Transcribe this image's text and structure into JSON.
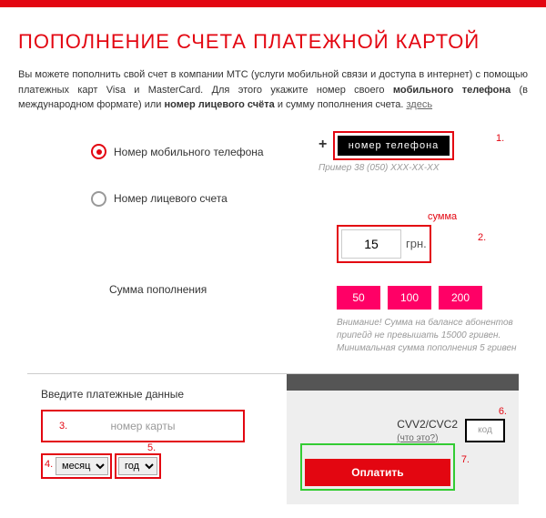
{
  "title": "ПОПОЛНЕНИЕ СЧЕТА ПЛАТЕЖНОЙ КАРТОЙ",
  "intro": {
    "p1": "Вы можете пополнить свой счет в компании МТС (услуги мобильной связи и доступа в интернет) с помощью платежных карт Visa и MasterCard. Для этого укажите номер своего ",
    "b1": "мобильного телефона",
    "p2": " (в международном формате) или ",
    "b2": "номер лицевого счёта",
    "p3": " и сумму пополнения счета. ",
    "link": "здесь"
  },
  "form": {
    "opt1": "Номер мобильного телефона",
    "opt2": "Номер лицевого счета",
    "phone_ph": "номер телефона",
    "phone_hint": "Пример 38 (050) XXX-XX-XX",
    "amount_label": "Сумма пополнения",
    "amount_val": "15",
    "currency": "грн.",
    "anno_sum": "сумма",
    "chips": [
      "50",
      "100",
      "200"
    ],
    "warn": "Внимание! Сумма на балансе абонентов припейд не превышать 15000 гривен. Минимальная сумма пополнения 5 гривен"
  },
  "card": {
    "title": "Введите платежные данные",
    "num_ph": "номер карты",
    "month": "месяц",
    "year": "год",
    "cvv_label": "CVV2/CVC2",
    "cvv_q": "(что это?)",
    "cvv_ph": "код",
    "pay": "Оплатить"
  },
  "n": {
    "1": "1.",
    "2": "2.",
    "3": "3.",
    "4": "4.",
    "5": "5.",
    "6": "6.",
    "7": "7."
  }
}
